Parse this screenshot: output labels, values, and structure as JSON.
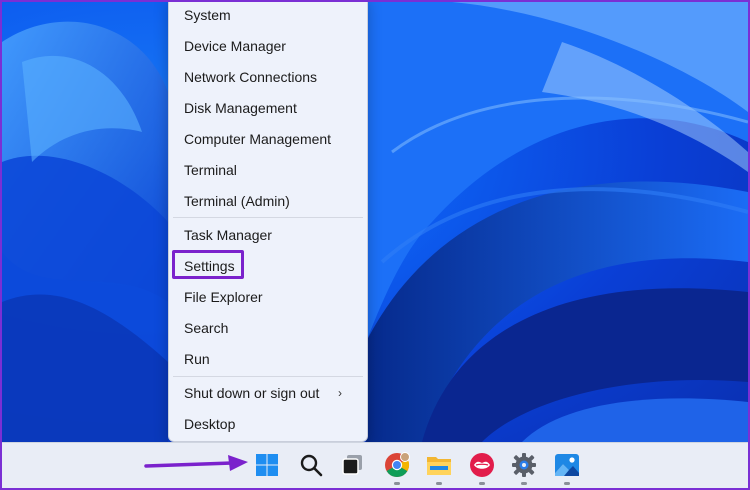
{
  "menu": {
    "items": [
      {
        "label": "System"
      },
      {
        "label": "Device Manager"
      },
      {
        "label": "Network Connections"
      },
      {
        "label": "Disk Management"
      },
      {
        "label": "Computer Management"
      },
      {
        "label": "Terminal"
      },
      {
        "label": "Terminal (Admin)"
      },
      {
        "label": "Task Manager"
      },
      {
        "label": "Settings"
      },
      {
        "label": "File Explorer"
      },
      {
        "label": "Search"
      },
      {
        "label": "Run"
      },
      {
        "label": "Shut down or sign out"
      },
      {
        "label": "Desktop"
      }
    ],
    "highlighted": "Settings",
    "submenu_chevron": "›"
  },
  "taskbar": {
    "icons": [
      {
        "name": "start-windows-icon"
      },
      {
        "name": "search-icon"
      },
      {
        "name": "task-view-icon"
      },
      {
        "name": "chrome-icon"
      },
      {
        "name": "file-explorer-icon"
      },
      {
        "name": "lips-app-icon"
      },
      {
        "name": "settings-gear-icon"
      },
      {
        "name": "photos-icon"
      }
    ]
  },
  "colors": {
    "annotation": "#7b22cc",
    "menu_bg": "#eef2fb",
    "taskbar_bg": "#e9edf6",
    "wallpaper": "#0d5df0"
  }
}
